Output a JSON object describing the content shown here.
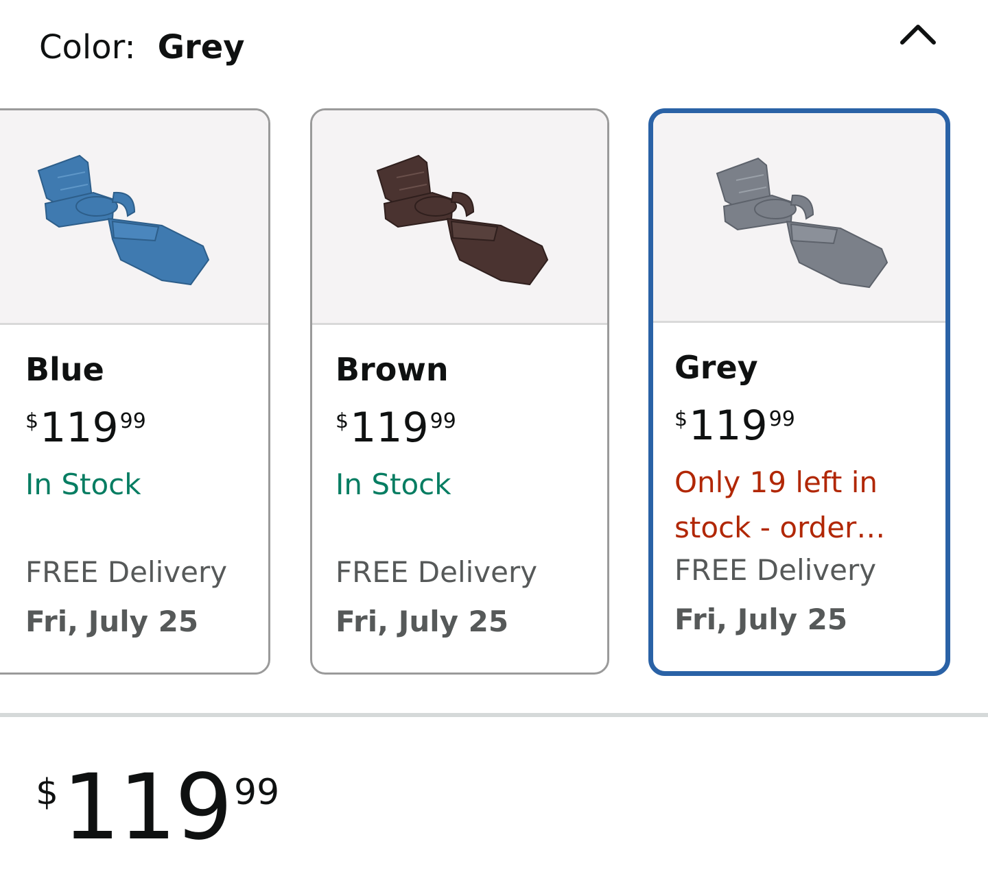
{
  "header": {
    "label": "Color:",
    "selected_value": "Grey",
    "collapse_icon": "chevron-up-icon"
  },
  "swatches": [
    {
      "name": "Blue",
      "price": {
        "currency": "$",
        "whole": "119",
        "fraction": "99"
      },
      "stock": "In Stock",
      "delivery_label": "FREE Delivery",
      "delivery_date": "Fri, July 25",
      "chair_color": "#3f7ab0",
      "selected": false
    },
    {
      "name": "Brown",
      "price": {
        "currency": "$",
        "whole": "119",
        "fraction": "99"
      },
      "stock": "In Stock",
      "delivery_label": "FREE Delivery",
      "delivery_date": "Fri, July 25",
      "chair_color": "#4a3330",
      "selected": false
    },
    {
      "name": "Grey",
      "price": {
        "currency": "$",
        "whole": "119",
        "fraction": "99"
      },
      "stock": "Only 19 left in stock - order…",
      "delivery_label": "FREE Delivery",
      "delivery_date": "Fri, July 25",
      "chair_color": "#7b8089",
      "selected": true
    }
  ],
  "main_price": {
    "currency": "$",
    "whole": "119",
    "fraction": "99"
  },
  "colors": {
    "in_stock": "#067d62",
    "low_stock": "#b12704",
    "selected_border": "#2a62a6",
    "card_border": "#9a9a9a",
    "divider": "#d5d9d9"
  }
}
